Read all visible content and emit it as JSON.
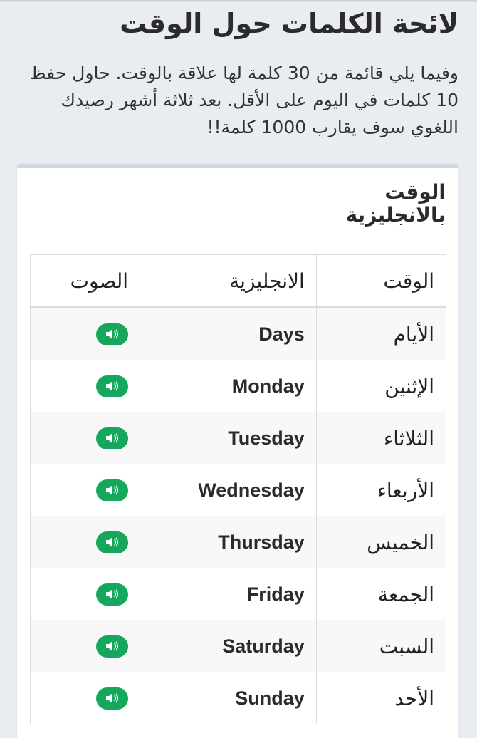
{
  "page": {
    "title": "لائحة الكلمات حول الوقت",
    "intro": "وفيما يلي قائمة من 30 كلمة لها علاقة بالوقت. حاول حفظ 10 كلمات في اليوم على الأقل. بعد ثلاثة أشهر رصيدك اللغوي سوف يقارب 1000 كلمة!!"
  },
  "card": {
    "title": "الوقت بالانجليزية"
  },
  "table": {
    "headers": {
      "arabic": "الوقت",
      "english": "الانجليزية",
      "sound": "الصوت"
    },
    "sound_icon": "speaker-volume-icon",
    "accent_color": "#16a75c",
    "rows": [
      {
        "arabic": "الأيام",
        "english": "Days"
      },
      {
        "arabic": "الإثنين",
        "english": "Monday"
      },
      {
        "arabic": "الثلاثاء",
        "english": "Tuesday"
      },
      {
        "arabic": "الأربعاء",
        "english": "Wednesday"
      },
      {
        "arabic": "الخميس",
        "english": "Thursday"
      },
      {
        "arabic": "الجمعة",
        "english": "Friday"
      },
      {
        "arabic": "السبت",
        "english": "Saturday"
      },
      {
        "arabic": "الأحد",
        "english": "Sunday"
      }
    ]
  }
}
